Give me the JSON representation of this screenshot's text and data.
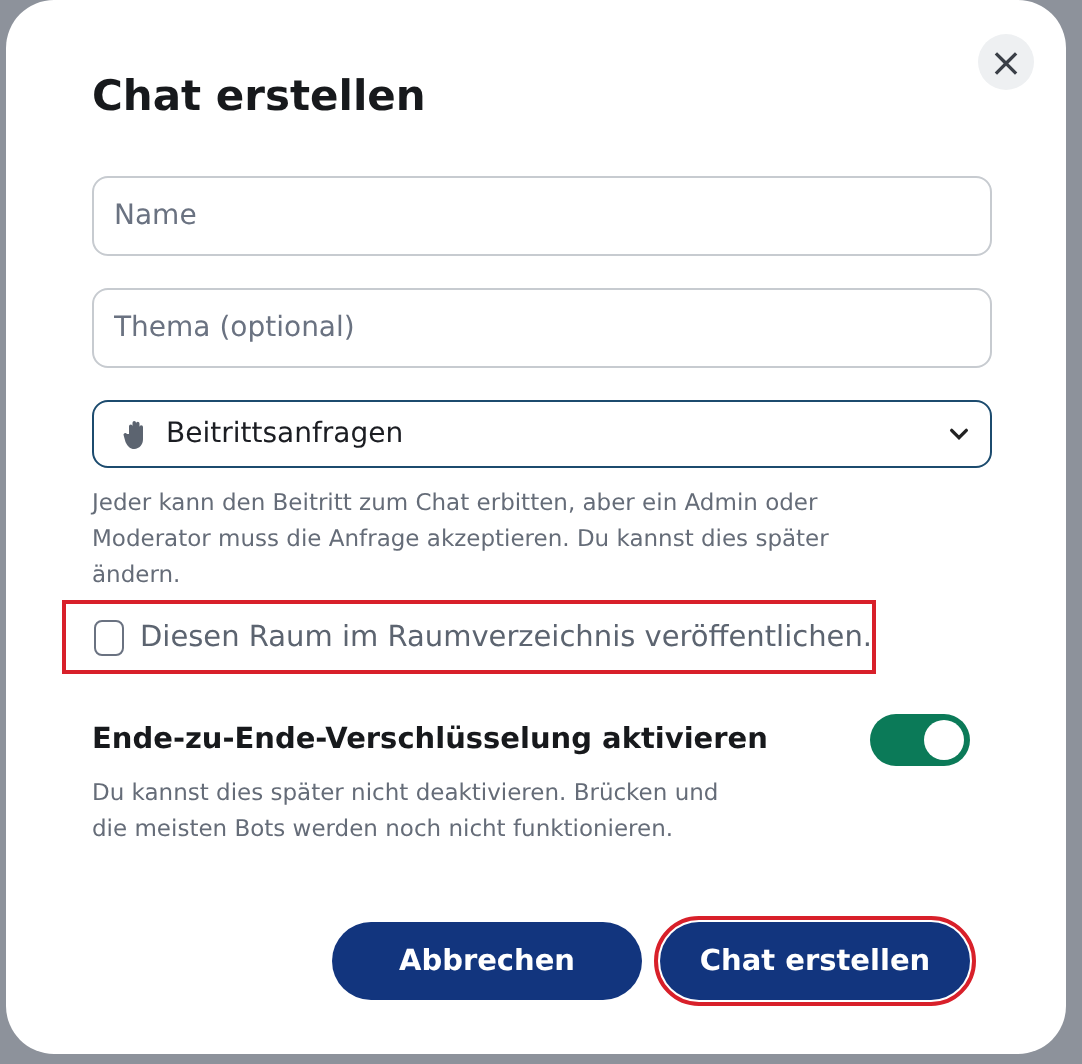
{
  "dialog": {
    "title": "Chat erstellen",
    "close_label": "×"
  },
  "fields": [
    {
      "placeholder": "Name"
    },
    {
      "placeholder": "Thema (optional)"
    }
  ],
  "join_rule": {
    "value": "Beitrittsanfragen",
    "description": "Jeder kann den Beitritt zum Chat erbitten, aber ein Admin oder Moderator muss die Anfrage akzeptieren. Du kannst dies später ändern."
  },
  "publish": {
    "label": "Diesen Raum im Raumverzeichnis veröffentlichen.",
    "checked": false,
    "highlighted": true
  },
  "encryption": {
    "label": "Ende-zu-Ende-Verschlüsselung aktivieren",
    "on": true,
    "description": "Du kannst dies später nicht deaktivieren. Brücken und die meisten Bots werden noch nicht funktionieren."
  },
  "buttons": [
    {
      "label": "Abbrechen",
      "highlighted": false
    },
    {
      "label": "Chat erstellen",
      "highlighted": true
    }
  ]
}
